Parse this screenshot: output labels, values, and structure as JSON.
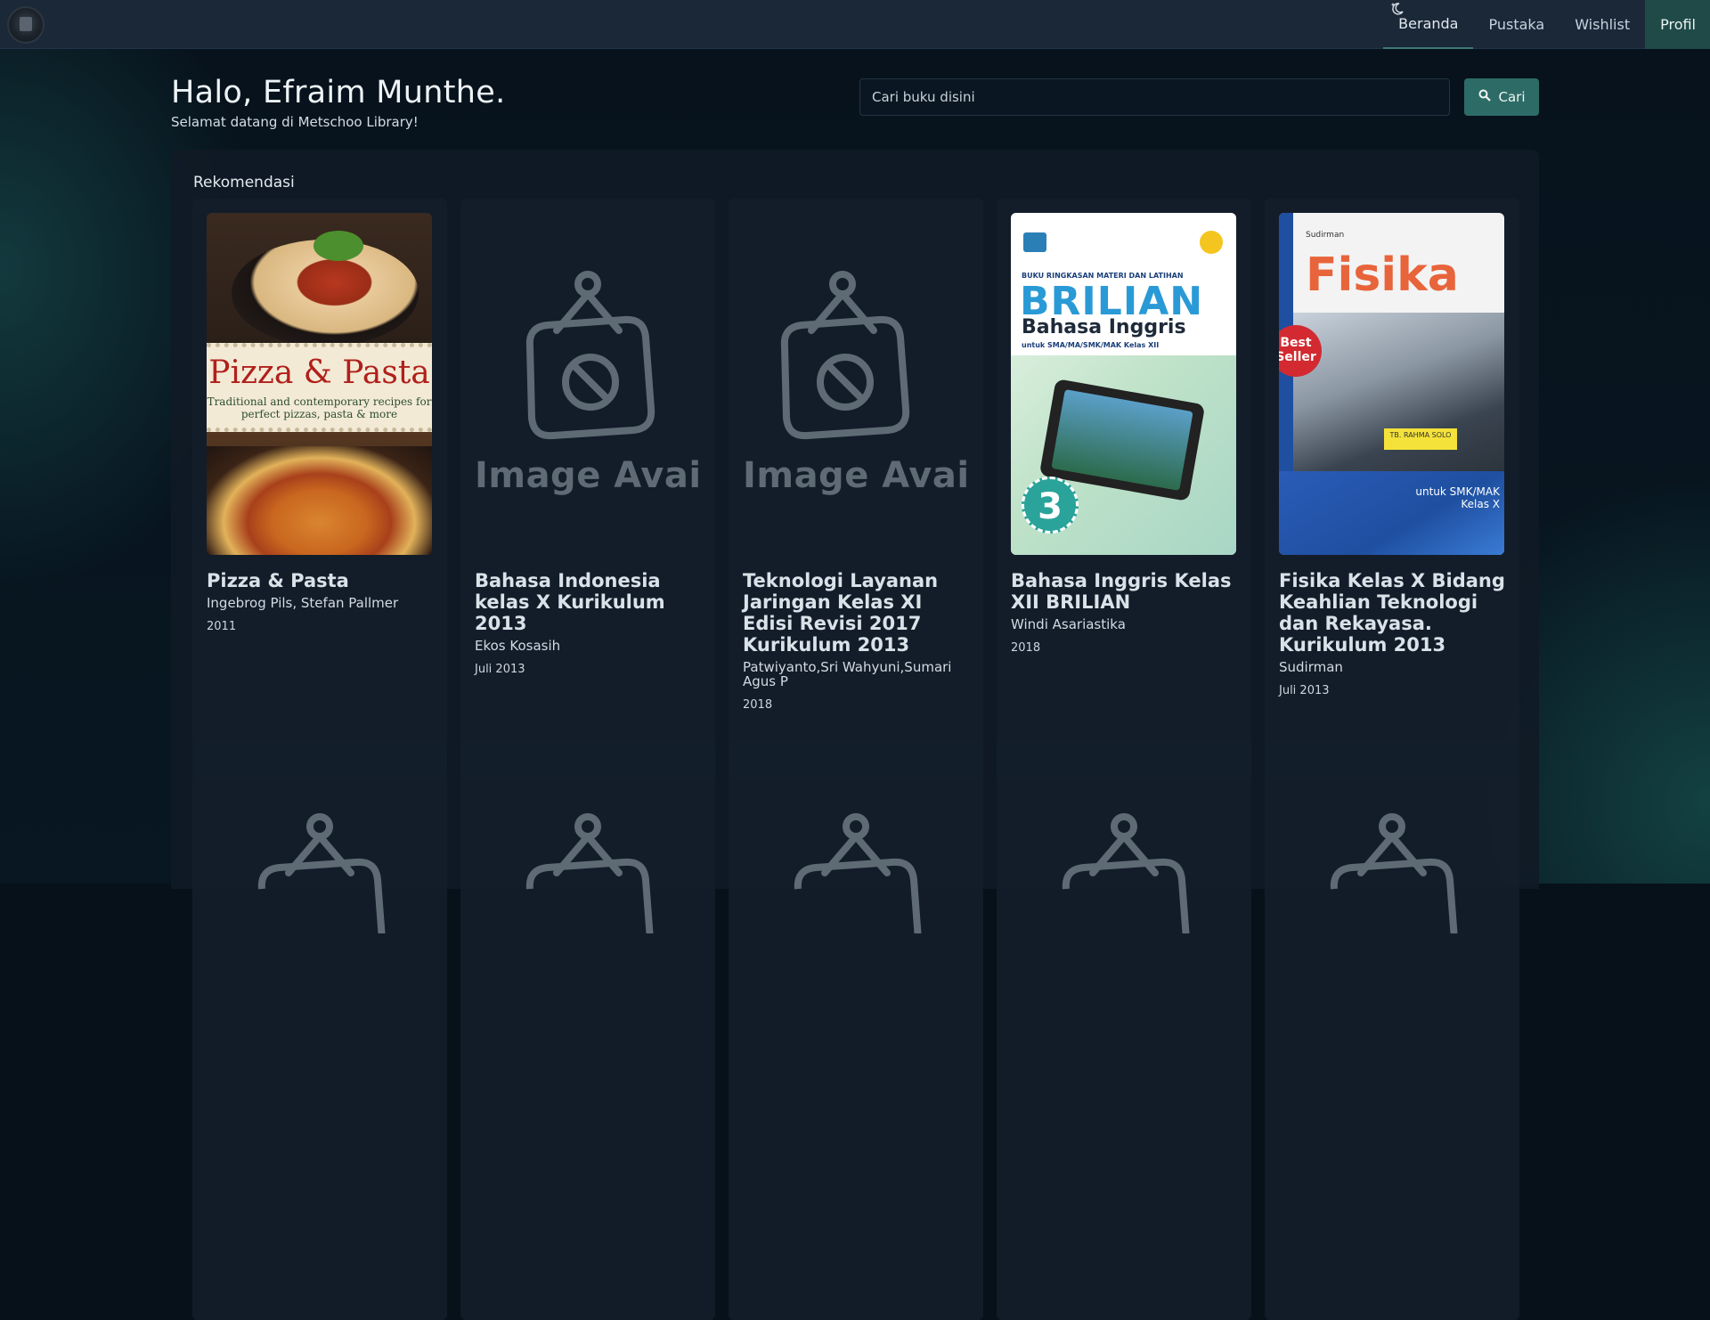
{
  "nav": {
    "links": [
      {
        "label": "Beranda"
      },
      {
        "label": "Pustaka"
      },
      {
        "label": "Wishlist"
      },
      {
        "label": "Profil"
      }
    ],
    "theme_icon": "moon-icon",
    "logo_icon": "school-logo-icon"
  },
  "header": {
    "greeting": "Halo, Efraim Munthe.",
    "subtitle": "Selamat datang di Metschoo Library!"
  },
  "search": {
    "placeholder": "Cari buku disini",
    "value": "",
    "button_label": "Cari",
    "button_icon": "search-icon"
  },
  "recommendations": {
    "title": "Rekomendasi",
    "placeholder_text": "Image Availa",
    "books": [
      {
        "title": "Pizza & Pasta",
        "author": "Ingebrog Pils, Stefan Pallmer",
        "year": "2011",
        "cover": {
          "title": "Pizza & Pasta",
          "subtitle": "Traditional and contemporary recipes for perfect pizzas, pasta & more"
        }
      },
      {
        "title": "Bahasa Indonesia kelas X Kurikulum 2013",
        "author": "Ekos Kosasih",
        "year": "Juli 2013"
      },
      {
        "title": "Teknologi Layanan Jaringan Kelas XI Edisi Revisi 2017 Kurikulum 2013",
        "author": "Patwiyanto,Sri Wahyuni,Sumari Agus P",
        "year": "2018"
      },
      {
        "title": "Bahasa Inggris Kelas XII BRILIAN",
        "author": "Windi Asariastika",
        "year": "2018",
        "cover": {
          "header": "BUKU RINGKASAN MATERI DAN LATIHAN",
          "brand": "BRILIAN",
          "subject": "Bahasa Inggris",
          "for": "untuk SMA/MA/SMK/MAK Kelas XII",
          "number": "3"
        }
      },
      {
        "title": "Fisika Kelas X Bidang Keahlian Teknologi dan Rekayasa. Kurikulum 2013",
        "author": "Sudirman",
        "year": "Juli 2013",
        "cover": {
          "author": "Sudirman",
          "title": "Fisika",
          "badge": "Best Seller",
          "label": "TB. RAHMA SOLO",
          "for": "untuk SMK/MAK Kelas X"
        }
      }
    ]
  },
  "colors": {
    "navbar": "#1b2838",
    "accent": "#2d6b66",
    "profile_bg": "#1f4a47",
    "placeholder_icon": "#5e6a74"
  }
}
